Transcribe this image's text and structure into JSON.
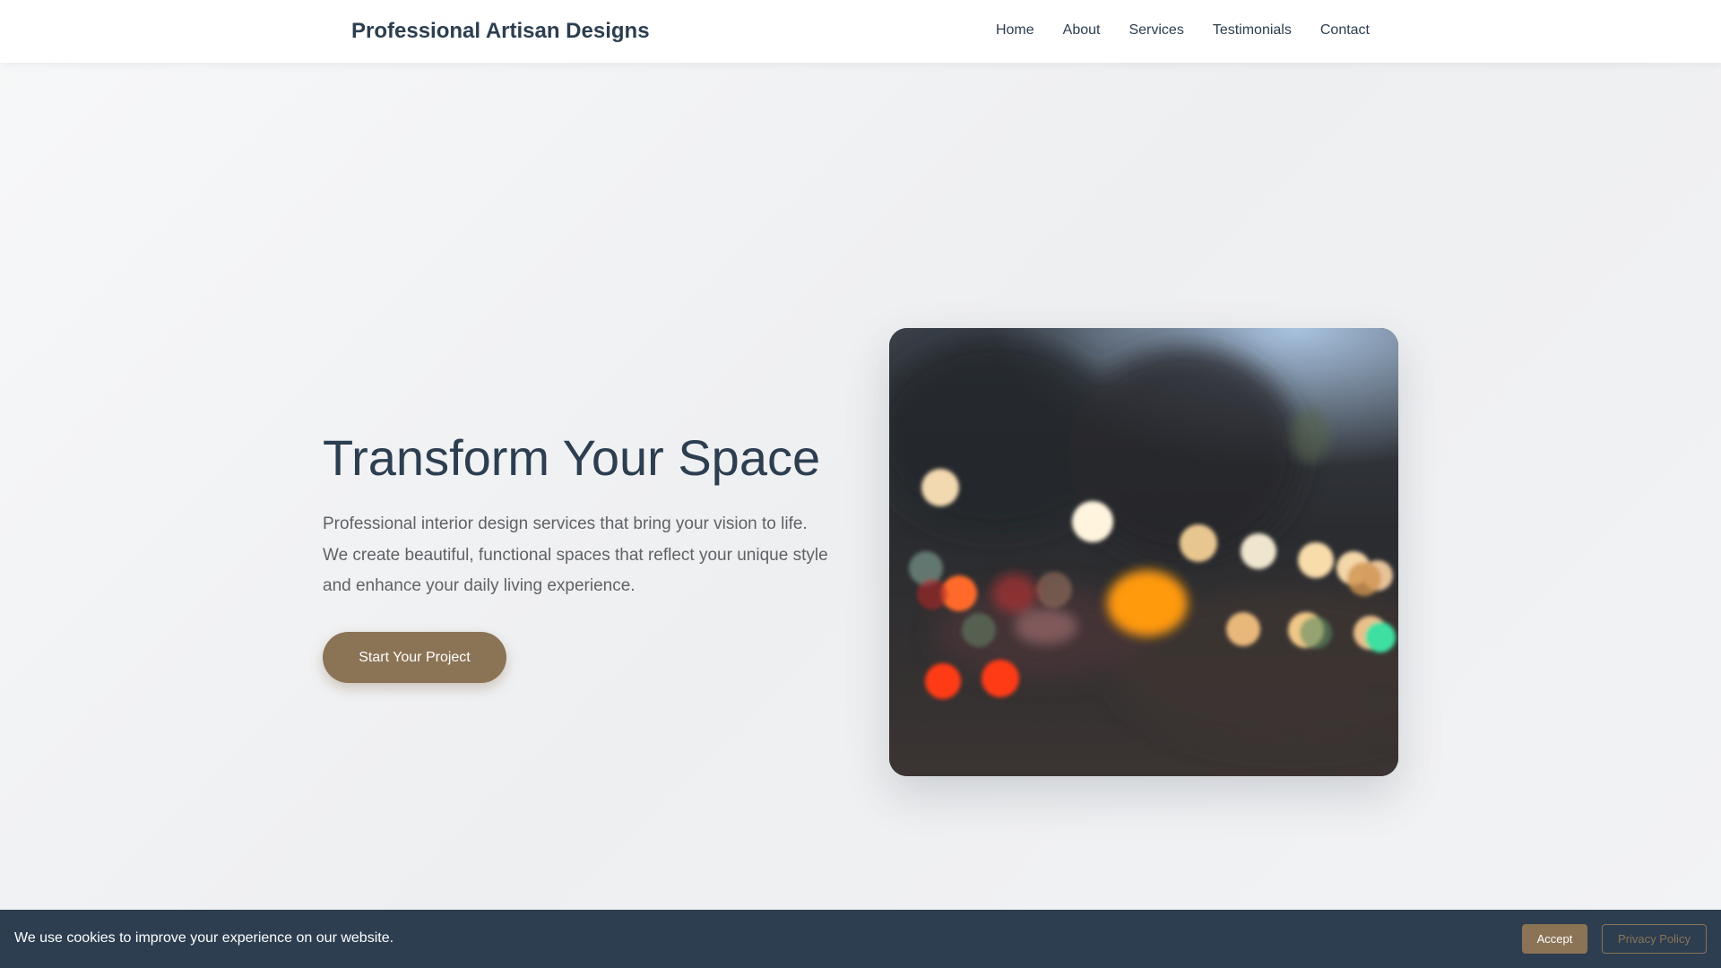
{
  "header": {
    "logo": "Professional Artisan Designs",
    "nav": [
      {
        "label": "Home"
      },
      {
        "label": "About"
      },
      {
        "label": "Services"
      },
      {
        "label": "Testimonials"
      },
      {
        "label": "Contact"
      }
    ]
  },
  "hero": {
    "title": "Transform Your Space",
    "description": "Professional interior design services that bring your vision to life. We create beautiful, functional spaces that reflect your unique style and enhance your daily living experience.",
    "cta_label": "Start Your Project",
    "image": {
      "subject": "blurred bokeh city street lights at dusk"
    }
  },
  "cookie_banner": {
    "message": "We use cookies to improve your experience on our website.",
    "accept_label": "Accept",
    "privacy_label": "Privacy Policy"
  },
  "colors": {
    "accent": "#8b7355",
    "heading": "#2c3e50",
    "banner_bg": "#2c3e50",
    "body_text": "#5f6266"
  }
}
